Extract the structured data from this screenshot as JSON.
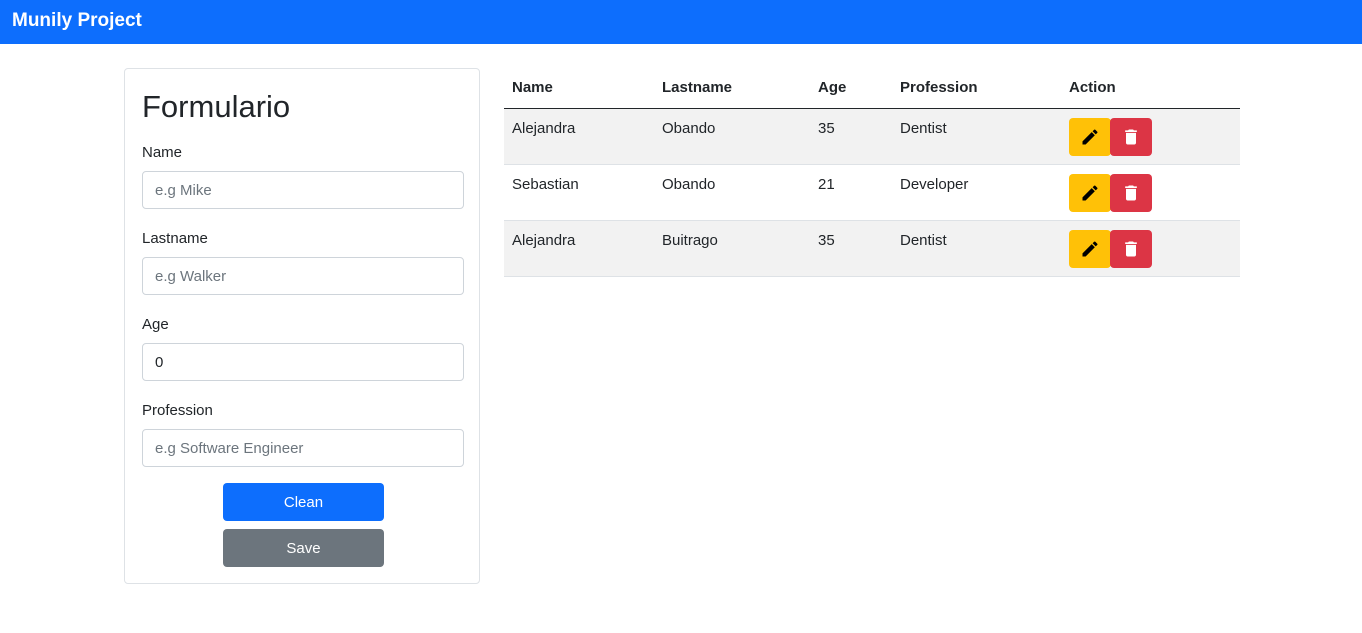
{
  "navbar": {
    "brand": "Munily Project"
  },
  "form": {
    "title": "Formulario",
    "fields": [
      {
        "label": "Name",
        "placeholder": "e.g Mike",
        "value": ""
      },
      {
        "label": "Lastname",
        "placeholder": "e.g Walker",
        "value": ""
      },
      {
        "label": "Age",
        "placeholder": "",
        "value": "0"
      },
      {
        "label": "Profession",
        "placeholder": "e.g Software Engineer",
        "value": ""
      }
    ],
    "clean_label": "Clean",
    "save_label": "Save"
  },
  "table": {
    "headers": [
      "Name",
      "Lastname",
      "Age",
      "Profession",
      "Action"
    ],
    "rows": [
      {
        "name": "Alejandra",
        "lastname": "Obando",
        "age": "35",
        "profession": "Dentist",
        "edit_icon": "pencil-icon",
        "delete_icon": "trash-icon"
      },
      {
        "name": "Sebastian",
        "lastname": "Obando",
        "age": "21",
        "profession": "Developer",
        "edit_icon": "pencil-icon",
        "delete_icon": "trash-icon"
      },
      {
        "name": "Alejandra",
        "lastname": "Buitrago",
        "age": "35",
        "profession": "Dentist",
        "edit_icon": "pencil-icon",
        "delete_icon": "trash-icon"
      }
    ]
  },
  "colors": {
    "primary": "#0d6efd",
    "secondary": "#6c757d",
    "warning": "#ffc107",
    "danger": "#dc3545",
    "stripe": "#f2f2f2"
  }
}
